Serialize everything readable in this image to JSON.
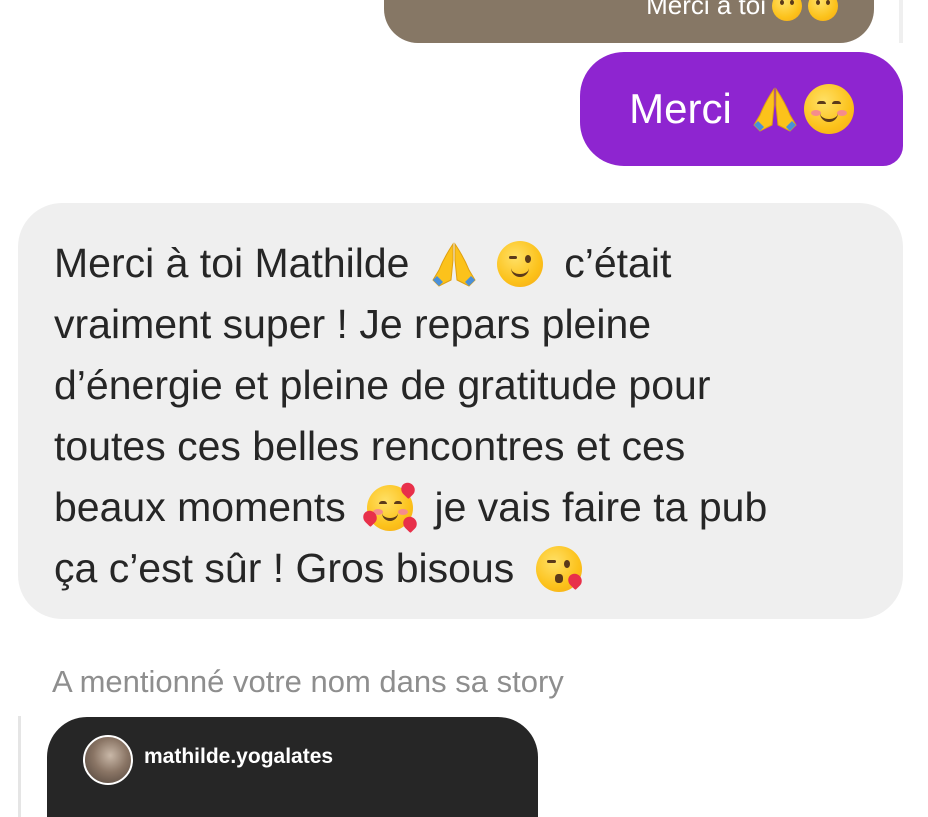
{
  "thread": {
    "reply_preview": {
      "text": "Merci à toi",
      "emojis": [
        "smiling-face-icon",
        "smiling-face-icon"
      ],
      "color": "#867765"
    },
    "sent_message": {
      "text": "Merci",
      "emojis": [
        "folded-hands-icon",
        "smiling-blush-icon"
      ],
      "color": "#8e25d0"
    },
    "received_message": {
      "lines": [
        "Merci à toi Mathilde ",
        " c’était",
        "vraiment super ! Je repars pleine",
        "d’énergie et pleine de gratitude pour",
        "toutes ces belles rencontres et ces",
        "beaux moments ",
        " je vais faire ta pub",
        "ça c’est sûr ! Gros bisous "
      ],
      "emojis": [
        "folded-hands-icon",
        "winking-face-icon",
        "smiling-face-hearts-icon",
        "kissing-heart-face-icon"
      ],
      "color": "#efefef"
    },
    "mention": {
      "caption": "A mentionné votre nom dans sa story",
      "story_username": "mathilde.yogalates"
    }
  }
}
